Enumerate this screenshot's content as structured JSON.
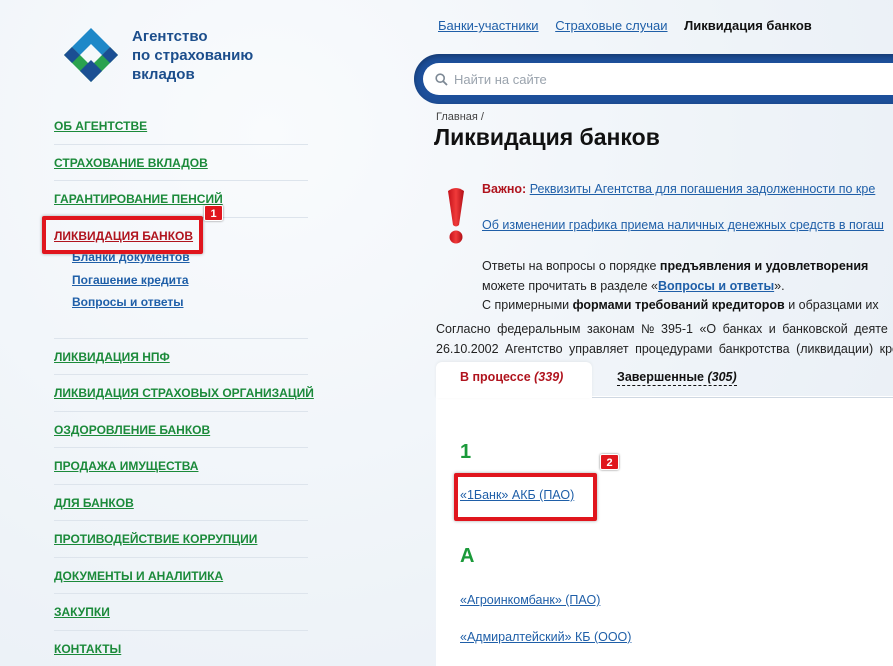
{
  "logo": {
    "lines": [
      "Агентство",
      "по страхованию",
      "вкладов"
    ]
  },
  "leftnav": {
    "items_top": [
      {
        "label": "ОБ АГЕНТСТВЕ"
      },
      {
        "label": "СТРАХОВАНИЕ ВКЛАДОВ"
      },
      {
        "label": "ГАРАНТИРОВАНИЕ ПЕНСИЙ"
      }
    ],
    "active": {
      "label": "ЛИКВИДАЦИЯ БАНКОВ"
    },
    "subitems": [
      {
        "label": "Бланки документов"
      },
      {
        "label": "Погашение кредита"
      },
      {
        "label": "Вопросы и ответы"
      }
    ],
    "items_bottom": [
      {
        "label": "ЛИКВИДАЦИЯ НПФ"
      },
      {
        "label": "ЛИКВИДАЦИЯ СТРАХОВЫХ ОРГАНИЗАЦИЙ"
      },
      {
        "label": "ОЗДОРОВЛЕНИЕ БАНКОВ"
      },
      {
        "label": "ПРОДАЖА ИМУЩЕСТВА"
      },
      {
        "label": "ДЛЯ БАНКОВ"
      },
      {
        "label": "ПРОТИВОДЕЙСТВИЕ КОРРУПЦИИ"
      },
      {
        "label": "ДОКУМЕНТЫ И АНАЛИТИКА"
      },
      {
        "label": "ЗАКУПКИ"
      },
      {
        "label": "КОНТАКТЫ"
      }
    ]
  },
  "badges": {
    "first": "1",
    "second": "2"
  },
  "toplinks": {
    "link1": "Банки-участники",
    "link2": "Страховые случаи",
    "current": "Ликвидация банков"
  },
  "search": {
    "placeholder": "Найти на сайте"
  },
  "breadcrumb": "Главная /",
  "page_title": "Ликвидация банков",
  "notice": {
    "important_label": "Важно:",
    "link1": "Реквизиты Агентства для погашения задолженности по кре",
    "link2": "Об изменении графика приема наличных денежных средств в погаш"
  },
  "para": {
    "line1_start": "Ответы на вопросы о порядке ",
    "line1_bold": "предъявления и удовлетворения",
    "line2_start": "можете прочитать в разделе «",
    "line2_link": "Вопросы и ответы",
    "line2_end": "».",
    "line3_start": "С примерными ",
    "line3_bold": "формами требований кредиторов",
    "line3_end": " и образцами их"
  },
  "law": {
    "line1": "Согласно федеральным законам № 395-1 «О банках и банковской деяте",
    "line2": "26.10.2002 Агентство управляет процедурами банкротства (ликвидации) кре"
  },
  "tabs": {
    "active_label": "В процессе ",
    "active_count": "(339)",
    "inactive_label": "Завершенные ",
    "inactive_count": "(305)"
  },
  "banks": {
    "group1_letter": "1",
    "group1_bank": "«1Банк» АКБ (ПАО)",
    "group2_letter": "А",
    "group2_banks": [
      "«Агроинкомбанк» (ПАО)",
      "«Адмиралтейский» КБ (ООО)"
    ]
  },
  "colors": {
    "nav_green": "#1b8a3a",
    "active_red": "#b0141e",
    "link_blue": "#1f5fa8",
    "search_blue": "#1d4f9a",
    "highlight_red": "#e0151d"
  }
}
